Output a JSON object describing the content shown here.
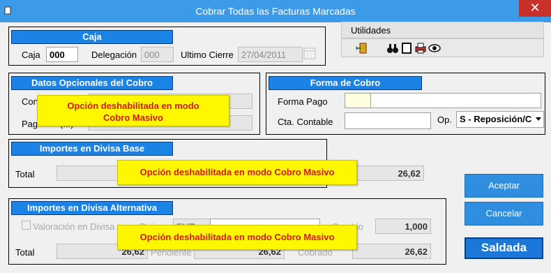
{
  "window": {
    "title": "Cobrar Todas las Facturas Marcadas",
    "close_label": "✕"
  },
  "toolbar": {
    "menu_label": "Utilidades",
    "icons": [
      "exit-door-icon",
      "binoculars-icon",
      "document-icon",
      "printer-icon",
      "eye-icon"
    ]
  },
  "caja": {
    "header": "Caja",
    "caja_label": "Caja",
    "caja_value": "000",
    "delegacion_label": "Delegación",
    "delegacion_value": "000",
    "ultimo_cierre_label": "Ultimo Cierre",
    "ultimo_cierre_value": "27/04/2011"
  },
  "datos_opcionales": {
    "header": "Datos Opcionales del Cobro",
    "concepto_label": "Con",
    "pagado_label": "Pag",
    "pagado_label_tail": "(...)",
    "disabled_note_line1": "Opción deshabilitada en modo",
    "disabled_note_line2": "Cobro Masivo"
  },
  "forma_cobro": {
    "header": "Forma de Cobro",
    "forma_pago_label": "Forma Pago",
    "forma_pago_code": "",
    "forma_pago_desc": "",
    "cta_contable_label": "Cta. Contable",
    "cta_contable_value": "",
    "op_label": "Op.",
    "op_value": "S - Reposición/C"
  },
  "importes_base": {
    "header": "Importes en Divisa Base",
    "total_label": "Total",
    "total_value": "",
    "cobrado_value": "26,62",
    "disabled_note": "Opción deshabilitada en modo Cobro Masivo"
  },
  "importes_alt": {
    "header": "Importes en Divisa Alternativa",
    "valoracion_label": "Valoración en Divisa",
    "divisa_label": "Divi",
    "divisa_value": "EUR",
    "cambio_label": "Cambio",
    "cambio_value": "1,000",
    "total_label": "Total",
    "total_value": "26,62",
    "pendiente_label": "Pendiente",
    "pendiente_value": "26,62",
    "cobrado_label": "Cobrado",
    "cobrado_value": "26,62",
    "disabled_note": "Opción deshabilitada en modo Cobro Masivo"
  },
  "buttons": {
    "aceptar": "Aceptar",
    "cancelar": "Cancelar",
    "saldada": "Saldada"
  }
}
